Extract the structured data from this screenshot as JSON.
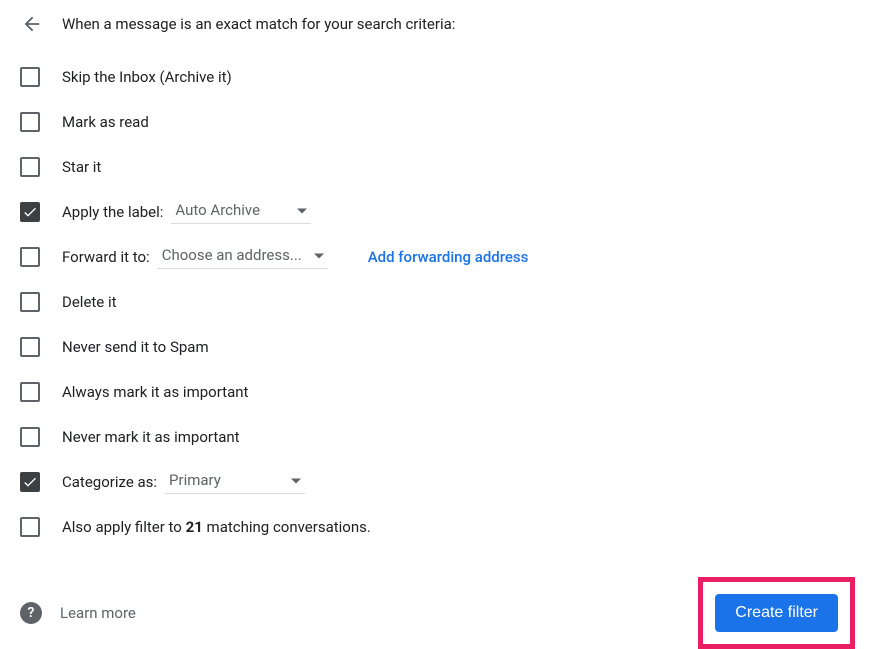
{
  "header": {
    "text": "When a message is an exact match for your search criteria:"
  },
  "options": {
    "skip_inbox": {
      "label": "Skip the Inbox (Archive it)",
      "checked": false
    },
    "mark_read": {
      "label": "Mark as read",
      "checked": false
    },
    "star_it": {
      "label": "Star it",
      "checked": false
    },
    "apply_label": {
      "label": "Apply the label:",
      "checked": true,
      "dropdown": "Auto Archive"
    },
    "forward_to": {
      "label": "Forward it to:",
      "checked": false,
      "dropdown": "Choose an address...",
      "link": "Add forwarding address"
    },
    "delete_it": {
      "label": "Delete it",
      "checked": false
    },
    "never_spam": {
      "label": "Never send it to Spam",
      "checked": false
    },
    "always_important": {
      "label": "Always mark it as important",
      "checked": false
    },
    "never_important": {
      "label": "Never mark it as important",
      "checked": false
    },
    "categorize": {
      "label": "Categorize as:",
      "checked": true,
      "dropdown": "Primary"
    },
    "also_apply": {
      "prefix": "Also apply filter to ",
      "count": "21",
      "suffix": " matching conversations.",
      "checked": false
    }
  },
  "footer": {
    "learn_more": "Learn more",
    "create_button": "Create filter"
  }
}
